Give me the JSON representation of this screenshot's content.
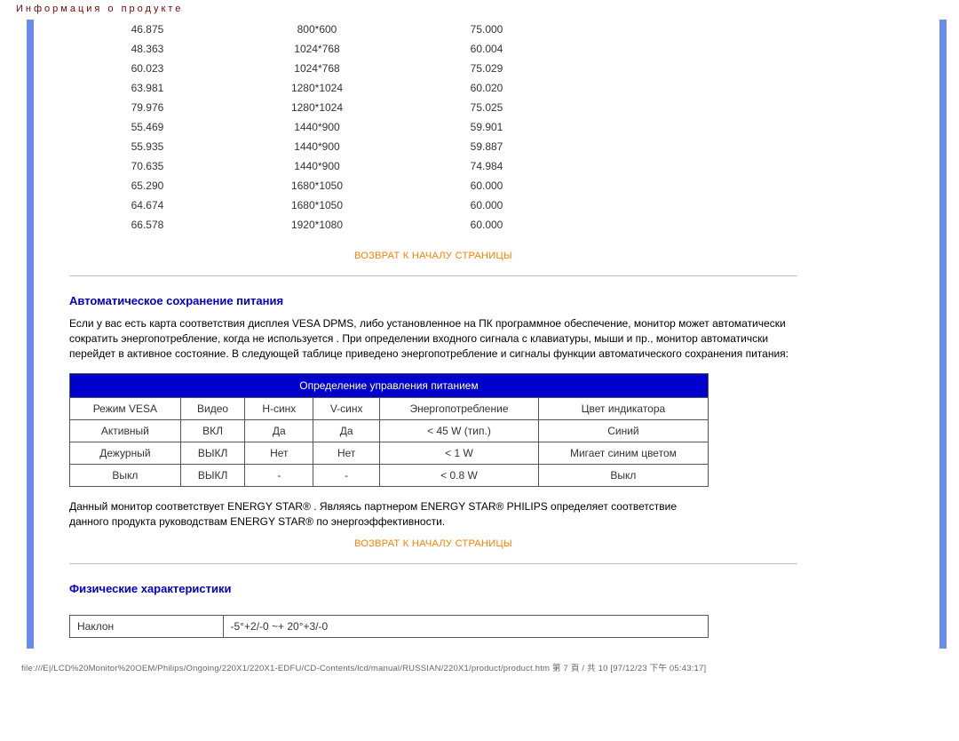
{
  "doc_title": "Информация о продукте",
  "modes": [
    {
      "f": "46.875",
      "res": "800*600",
      "v": "75.000"
    },
    {
      "f": "48.363",
      "res": "1024*768",
      "v": "60.004"
    },
    {
      "f": "60.023",
      "res": "1024*768",
      "v": "75.029"
    },
    {
      "f": "63.981",
      "res": "1280*1024",
      "v": "60.020"
    },
    {
      "f": "79.976",
      "res": "1280*1024",
      "v": "75.025"
    },
    {
      "f": "55.469",
      "res": "1440*900",
      "v": "59.901"
    },
    {
      "f": "55.935",
      "res": "1440*900",
      "v": "59.887"
    },
    {
      "f": "70.635",
      "res": "1440*900",
      "v": "74.984"
    },
    {
      "f": "65.290",
      "res": "1680*1050",
      "v": "60.000"
    },
    {
      "f": "64.674",
      "res": "1680*1050",
      "v": "60.000"
    },
    {
      "f": "66.578",
      "res": "1920*1080",
      "v": "60.000"
    }
  ],
  "return_link": "ВОЗВРАТ К НАЧАЛУ СТРАНИЦЫ",
  "power_save": {
    "title": "Автоматическое сохранение питания",
    "text": "Если у вас есть карта соответствия дисплея VESA DPMS, либо установленное на ПК программное обеспечение, монитор может автоматически сократить энергопотребление, когда не используется . При определении входного сигнала с клавиатуры, мыши и пр., монитор автоматичски перейдет в активное состояние. В следующей таблице приведено энергопотребление и сигналы функции автоматического сохранения питания:",
    "table_title": "Определение управления питанием",
    "headers": [
      "Режим VESA",
      "Видео",
      "Н-синх",
      "V-синх",
      "Энергопотребление",
      "Цвет индикатора"
    ],
    "rows": [
      [
        "Активный",
        "ВКЛ",
        "Да",
        "Да",
        "< 45 W (тип.)",
        "Синий"
      ],
      [
        "Дежурный",
        "ВЫКЛ",
        "Нет",
        "Нет",
        "< 1 W",
        "Мигает синим цветом"
      ],
      [
        "Выкл",
        "ВЫКЛ",
        "-",
        "-",
        "< 0.8 W",
        "Выкл"
      ]
    ],
    "note": "Данный монитор соответствует ENERGY STAR® . Являясь партнером ENERGY STAR® PHILIPS определяет соответствие данного продукта руководствам ENERGY STAR® по энергоэффективности."
  },
  "physical": {
    "title": "Физические характеристики",
    "rows": [
      [
        "Наклон",
        "-5°+2/-0 ~+ 20°+3/-0"
      ]
    ]
  },
  "footer": "file:///E|/LCD%20Monitor%20OEM/Philips/Ongoing/220X1/220X1-EDFU/CD-Contents/lcd/manual/RUSSIAN/220X1/product/product.htm 第 7 頁 / 共 10 [97/12/23 下午 05:43:17]"
}
